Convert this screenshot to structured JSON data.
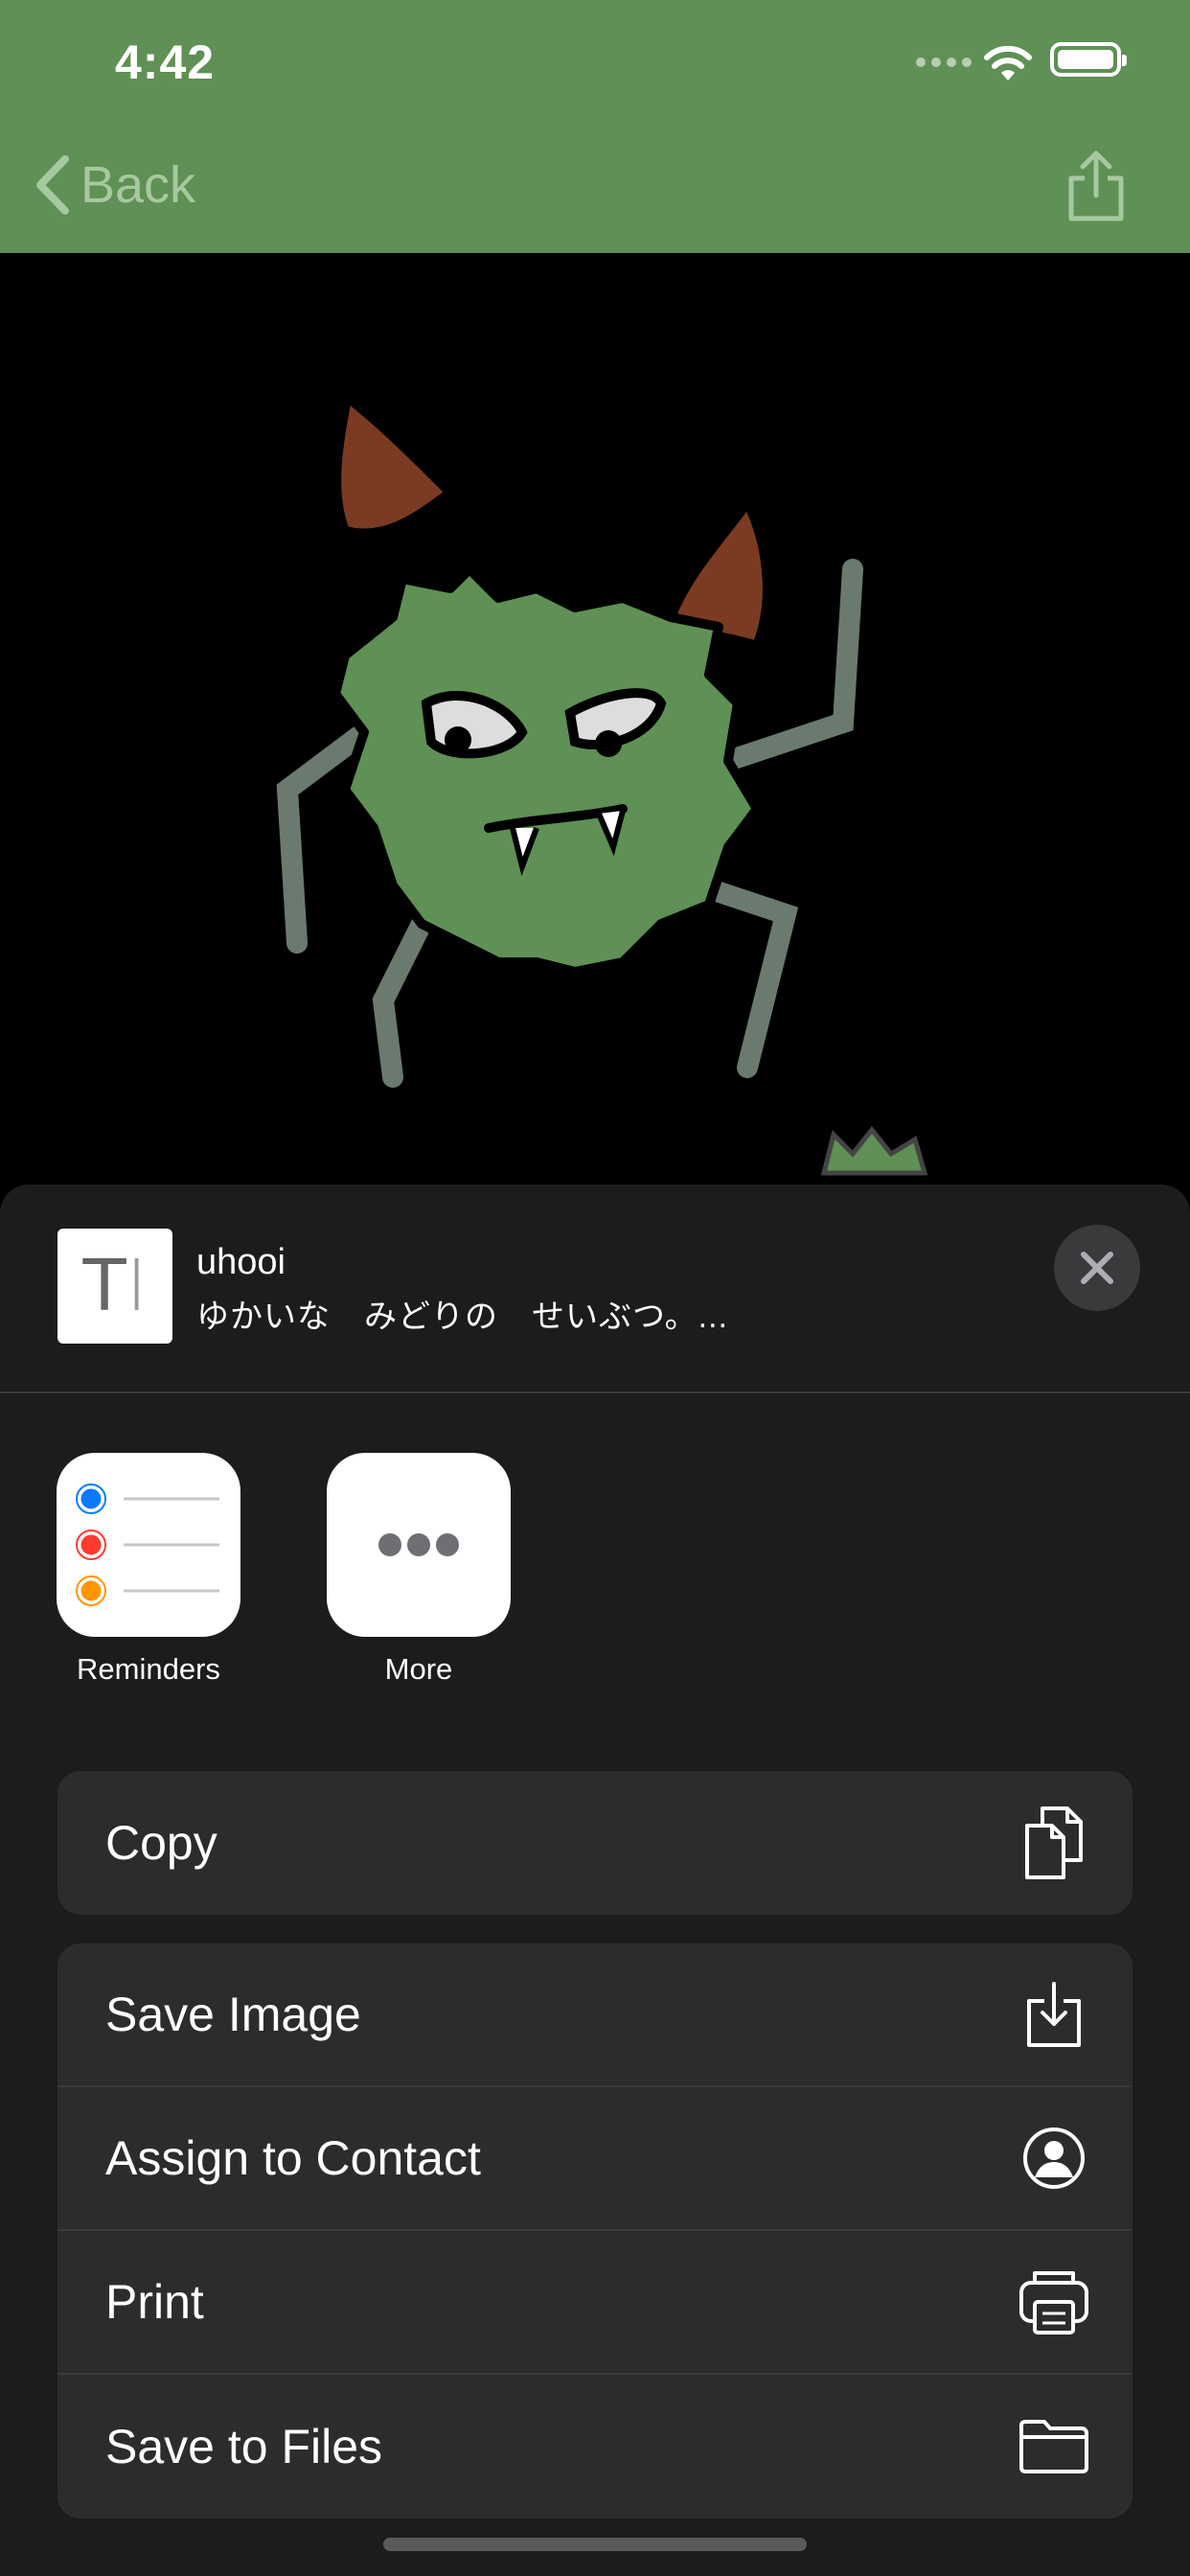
{
  "status_bar": {
    "time": "4:42"
  },
  "nav": {
    "back_label": "Back"
  },
  "share_sheet": {
    "title": "uhooi",
    "subtitle": "ゆかいな　みどりの　せいぶつ。...",
    "apps": [
      {
        "label": "Reminders",
        "icon": "reminders-icon"
      },
      {
        "label": "More",
        "icon": "more-icon"
      }
    ],
    "actions_group1": [
      {
        "label": "Copy",
        "icon": "copy-icon"
      }
    ],
    "actions_group2": [
      {
        "label": "Save Image",
        "icon": "save-image-icon"
      },
      {
        "label": "Assign to Contact",
        "icon": "contact-icon"
      },
      {
        "label": "Print",
        "icon": "print-icon"
      },
      {
        "label": "Save to Files",
        "icon": "folder-icon"
      }
    ]
  },
  "colors": {
    "nav_green": "#5f9055",
    "monster_green": "#5f9055",
    "sheet_bg": "#1c1c1e",
    "row_bg": "#2c2c2e"
  }
}
